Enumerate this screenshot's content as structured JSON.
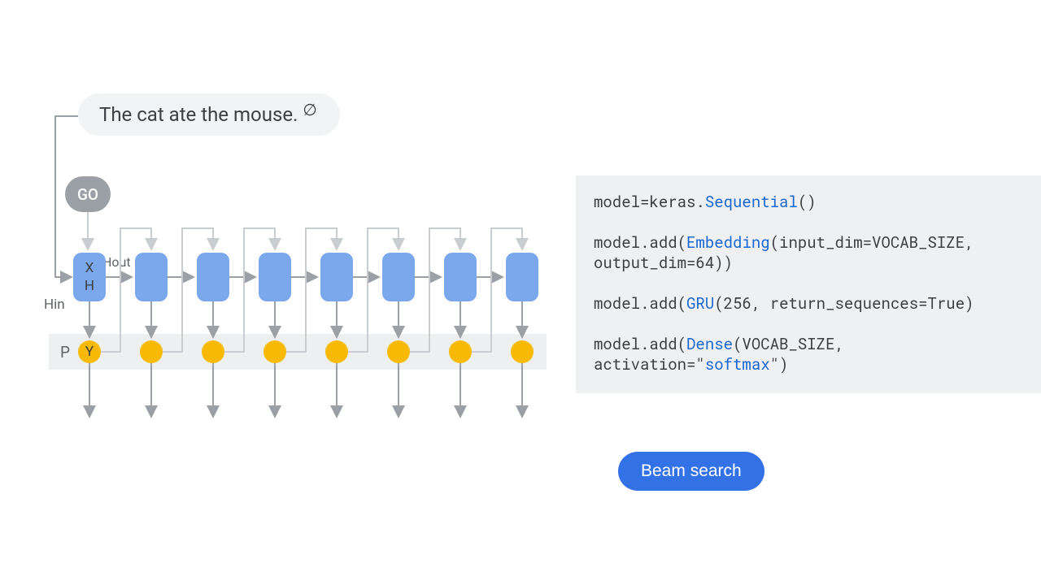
{
  "diagram": {
    "sentence": "The cat ate the mouse.",
    "empty_symbol": "∅",
    "go_label": "GO",
    "hin_label": "Hin",
    "hout_label": "Hout",
    "p_label": "P",
    "cell_x": "X",
    "cell_h": "H",
    "y_label": "Y",
    "num_cells": 8
  },
  "code": {
    "line1_a": "model=keras.",
    "line1_b": "Sequential",
    "line1_c": "()",
    "line2_a": "model.add(",
    "line2_b": "Embedding",
    "line2_c": "(input_dim=VOCAB_SIZE, output_dim=64))",
    "line3_a": "model.add(",
    "line3_b": "GRU",
    "line3_c": "(256, return_sequences=True)",
    "line4_a": "model.add(",
    "line4_b": "Dense",
    "line4_c": "(VOCAB_SIZE, activation=\"",
    "line4_d": "softmax",
    "line4_e": "\")"
  },
  "button": {
    "beam_label": "Beam search"
  }
}
